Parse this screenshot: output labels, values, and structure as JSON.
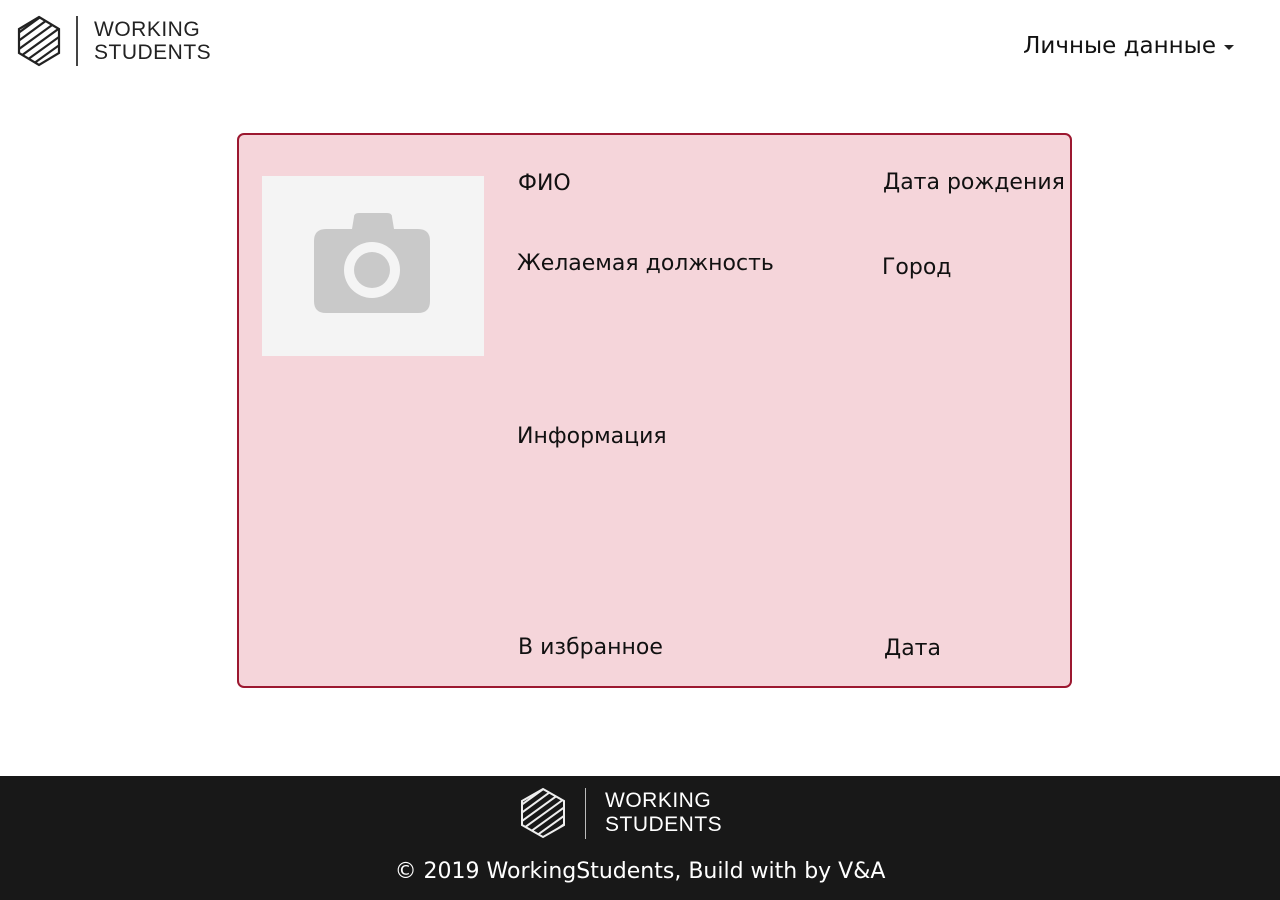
{
  "header": {
    "logo": {
      "line1": "WORKING",
      "line2": "STUDENTS"
    },
    "menu_label": "Личные данные"
  },
  "card": {
    "fio_label": "ФИО",
    "birthdate_label": "Дата рождения",
    "position_label": "Желаемая должность",
    "city_label": "Город",
    "info_label": "Информация",
    "favorite_label": "В избранное",
    "date_label": "Дата"
  },
  "footer": {
    "logo": {
      "line1": "WORKING",
      "line2": "STUDENTS"
    },
    "copyright": "© 2019 WorkingStudents, Build with by V&A"
  },
  "icons": {
    "logo_mark": "hexagon-stripes-logo-icon",
    "photo_placeholder": "camera-icon",
    "menu_caret": "caret-down-icon"
  },
  "colors": {
    "card_background": "#f5d5da",
    "card_border": "#9c1830",
    "footer_background": "#181818"
  }
}
